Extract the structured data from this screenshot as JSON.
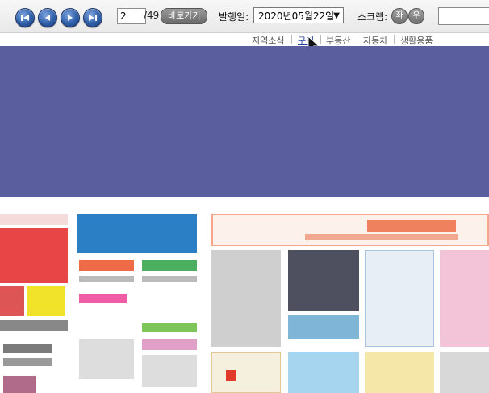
{
  "toolbar": {
    "nav_buttons": [
      {
        "icon": "first-page-icon"
      },
      {
        "icon": "previous-page-icon"
      },
      {
        "icon": "next-page-icon"
      },
      {
        "icon": "last-page-icon"
      }
    ],
    "page_value": "2",
    "page_total": "/49",
    "goto_label": "바로가기",
    "date_label": "발행일:",
    "date_value": "2020년05월22일",
    "scrap_label": "스크랩:",
    "scrap_left": "좌",
    "scrap_right": "우",
    "search_value": ""
  },
  "categories": [
    {
      "label": "지역소식",
      "active": false
    },
    {
      "label": "구인",
      "active": true
    },
    {
      "label": "부동산",
      "active": false
    },
    {
      "label": "자동차",
      "active": false
    },
    {
      "label": "생활용품",
      "active": false
    }
  ],
  "colors": {
    "banner": "#5a5e9e",
    "nav_button": "#2f5ea8",
    "active_category": "#1f3fa0"
  }
}
